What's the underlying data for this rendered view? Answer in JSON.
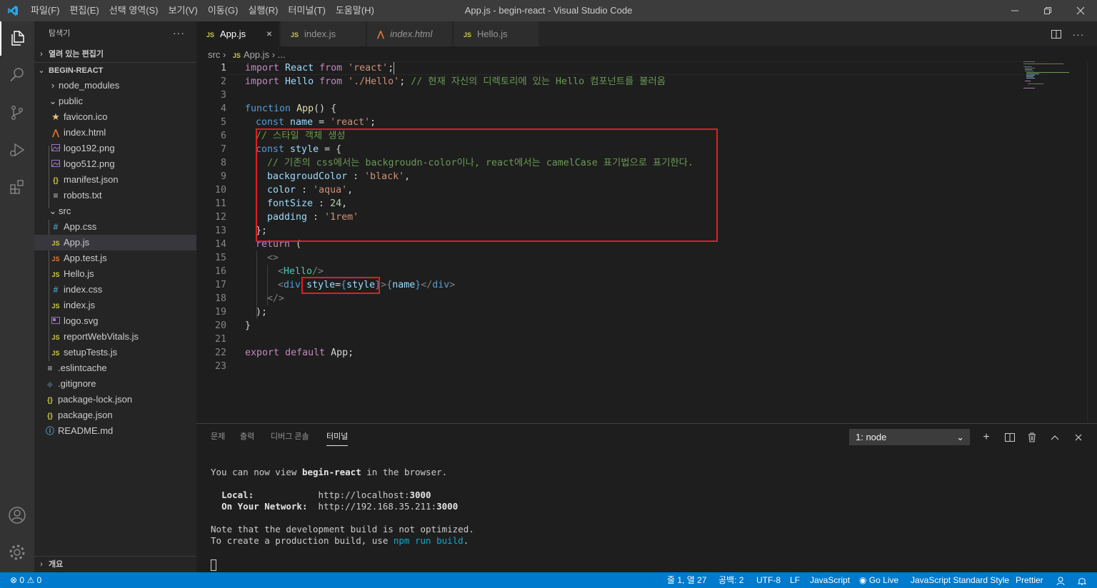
{
  "titlebar": {
    "menu": [
      "파일(F)",
      "편집(E)",
      "선택 영역(S)",
      "보기(V)",
      "이동(G)",
      "실행(R)",
      "터미널(T)",
      "도움말(H)"
    ],
    "window_title": "App.js - begin-react - Visual Studio Code",
    "controls": [
      "minimize",
      "restore",
      "close"
    ]
  },
  "activitybar": {
    "items": [
      "explorer-icon",
      "search-icon",
      "source-control-icon",
      "run-debug-icon",
      "extensions-icon"
    ],
    "bottom": [
      "account-icon",
      "manage-gear-icon"
    ]
  },
  "sidebar": {
    "title": "탐색기",
    "more": "···",
    "open_editors": "열려 있는 편집기",
    "project": "BEGIN-REACT",
    "outline": "개요",
    "tree": [
      {
        "label": "node_modules",
        "kind": "folder-collapsed"
      },
      {
        "label": "public",
        "kind": "folder-open"
      },
      {
        "label": "favicon.ico",
        "kind": "star"
      },
      {
        "label": "index.html",
        "kind": "html"
      },
      {
        "label": "logo192.png",
        "kind": "image"
      },
      {
        "label": "logo512.png",
        "kind": "image"
      },
      {
        "label": "manifest.json",
        "kind": "json"
      },
      {
        "label": "robots.txt",
        "kind": "text"
      },
      {
        "label": "src",
        "kind": "folder-open"
      },
      {
        "label": "App.css",
        "kind": "css"
      },
      {
        "label": "App.js",
        "kind": "js",
        "selected": true
      },
      {
        "label": "App.test.js",
        "kind": "js-test"
      },
      {
        "label": "Hello.js",
        "kind": "js"
      },
      {
        "label": "index.css",
        "kind": "css"
      },
      {
        "label": "index.js",
        "kind": "js"
      },
      {
        "label": "logo.svg",
        "kind": "svg"
      },
      {
        "label": "reportWebVitals.js",
        "kind": "js"
      },
      {
        "label": "setupTests.js",
        "kind": "js"
      },
      {
        "label": ".eslintcache",
        "kind": "text"
      },
      {
        "label": ".gitignore",
        "kind": "git"
      },
      {
        "label": "package-lock.json",
        "kind": "json"
      },
      {
        "label": "package.json",
        "kind": "json"
      },
      {
        "label": "README.md",
        "kind": "info"
      }
    ]
  },
  "tabs": [
    {
      "label": "App.js",
      "icon": "JS",
      "active": true,
      "close": "×"
    },
    {
      "label": "index.js",
      "icon": "JS"
    },
    {
      "label": "index.html",
      "icon": "html"
    },
    {
      "label": "Hello.js",
      "icon": "JS"
    }
  ],
  "breadcrumb": {
    "folder": "src",
    "file": "App.js",
    "icon": "JS",
    "rest": "..."
  },
  "editor": {
    "line_numbers": [
      "1",
      "2",
      "3",
      "4",
      "5",
      "6",
      "7",
      "8",
      "9",
      "10",
      "11",
      "12",
      "13",
      "14",
      "15",
      "16",
      "17",
      "18",
      "19",
      "20",
      "21",
      "22",
      "23"
    ],
    "lines": {
      "l1": [
        "import",
        " React ",
        "from",
        " ",
        "'react'",
        ";"
      ],
      "l2": [
        "import",
        " Hello ",
        "from",
        " ",
        "'./Hello'",
        "; ",
        "// 현재 자신의 디렉토리에 있는 Hello 컴포넌트를 불러옴"
      ],
      "l4": [
        "function",
        " ",
        "App",
        "() {"
      ],
      "l5": [
        "const",
        " ",
        "name",
        " = ",
        "'react'",
        ";"
      ],
      "l6": [
        "// 스타일 객체 생성"
      ],
      "l7": [
        "const",
        " ",
        "style",
        " = {"
      ],
      "l8": [
        "// 기존의 css에서는 backgroudn-color이나, react에서는 camelCase 표기법으로 표기한다."
      ],
      "l9": [
        "backgroudColor",
        " : ",
        "'black'",
        ","
      ],
      "l10": [
        "color",
        " : ",
        "'aqua'",
        ","
      ],
      "l11": [
        "fontSize",
        " : ",
        "24",
        ","
      ],
      "l12": [
        "padding",
        " : ",
        "'1rem'"
      ],
      "l13": [
        "};"
      ],
      "l14": [
        "return",
        " ("
      ],
      "l15": [
        "<>"
      ],
      "l16": [
        "<",
        "Hello",
        "/>"
      ],
      "l17": [
        "<",
        "div",
        " ",
        "style",
        "=",
        "{",
        "style",
        "}",
        ">",
        "{",
        "name",
        "}",
        "</",
        "div",
        ">"
      ],
      "l18": [
        "</>"
      ],
      "l19": [
        ");"
      ],
      "l20": [
        "}"
      ],
      "l22": [
        "export",
        " ",
        "default",
        " App;"
      ]
    }
  },
  "panel": {
    "tabs": [
      "문제",
      "출력",
      "디버그 콘솔",
      "터미널"
    ],
    "active_tab": "터미널",
    "terminal_select": "1: node",
    "actions": [
      "add-terminal-icon",
      "split-terminal-icon",
      "trash-icon",
      "maximize-panel-icon",
      "close-panel-icon"
    ],
    "terminal": {
      "line1_a": "You can now view ",
      "line1_b": "begin-react",
      "line1_c": " in the browser.",
      "local_label": "Local:",
      "local_url_a": "http://localhost:",
      "local_url_b": "3000",
      "network_label": "On Your Network:",
      "network_url_a": "http://192.168.35.211:",
      "network_url_b": "3000",
      "note1": "Note that the development build is not optimized.",
      "note2_a": "To create a production build, use ",
      "note2_b": "npm run build",
      "note2_c": "."
    }
  },
  "statusbar": {
    "errors": "0",
    "warnings": "0",
    "position": "줄 1, 열 27",
    "spaces": "공백: 2",
    "encoding": "UTF-8",
    "eol": "LF",
    "language": "JavaScript",
    "golive": "Go Live",
    "linter": "JavaScript Standard Style",
    "formatter": "Prettier"
  },
  "colors": {
    "accent": "#007acc",
    "annotation_box": "#e21d25"
  }
}
